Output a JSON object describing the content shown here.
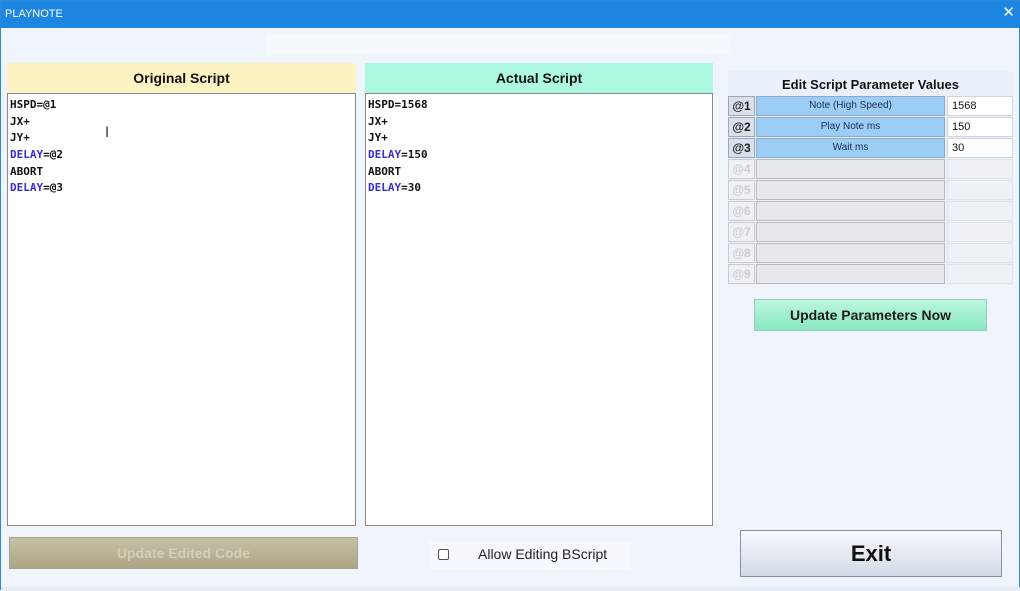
{
  "window": {
    "title": "PLAYNOTE",
    "close_glyph": "✕"
  },
  "original_script": {
    "header": "Original Script",
    "lines": [
      {
        "kw": "",
        "rest": "HSPD=@1"
      },
      {
        "kw": "",
        "rest": "JX+"
      },
      {
        "kw": "",
        "rest": "JY+"
      },
      {
        "kw": "DELAY",
        "rest": "=@2"
      },
      {
        "kw": "",
        "rest": "ABORT"
      },
      {
        "kw": "DELAY",
        "rest": "=@3"
      }
    ]
  },
  "actual_script": {
    "header": "Actual Script",
    "lines": [
      {
        "kw": "",
        "rest": "HSPD=1568"
      },
      {
        "kw": "",
        "rest": "JX+"
      },
      {
        "kw": "",
        "rest": "JY+"
      },
      {
        "kw": "DELAY",
        "rest": "=150"
      },
      {
        "kw": "",
        "rest": "ABORT"
      },
      {
        "kw": "DELAY",
        "rest": "=30"
      }
    ]
  },
  "params": {
    "title": "Edit Script Parameter Values",
    "rows": [
      {
        "id": "@1",
        "name": "Note (High Speed)",
        "value": "1568",
        "enabled": true
      },
      {
        "id": "@2",
        "name": "Play Note ms",
        "value": "150",
        "enabled": true
      },
      {
        "id": "@3",
        "name": "Wait ms",
        "value": "30",
        "enabled": true
      },
      {
        "id": "@4",
        "name": "",
        "value": "",
        "enabled": false
      },
      {
        "id": "@5",
        "name": "",
        "value": "",
        "enabled": false
      },
      {
        "id": "@6",
        "name": "",
        "value": "",
        "enabled": false
      },
      {
        "id": "@7",
        "name": "",
        "value": "",
        "enabled": false
      },
      {
        "id": "@8",
        "name": "",
        "value": "",
        "enabled": false
      },
      {
        "id": "@9",
        "name": "",
        "value": "",
        "enabled": false
      }
    ]
  },
  "buttons": {
    "update_params": "Update Parameters Now",
    "update_code": "Update Edited Code",
    "exit": "Exit"
  },
  "allow_editing": {
    "label": "Allow Editing BScript",
    "checked": false
  },
  "colors": {
    "titlebar": "#1d86e0",
    "keyword": "#3a2ccf",
    "original_header": "#fdf3c2",
    "actual_header": "#adf8e3"
  }
}
